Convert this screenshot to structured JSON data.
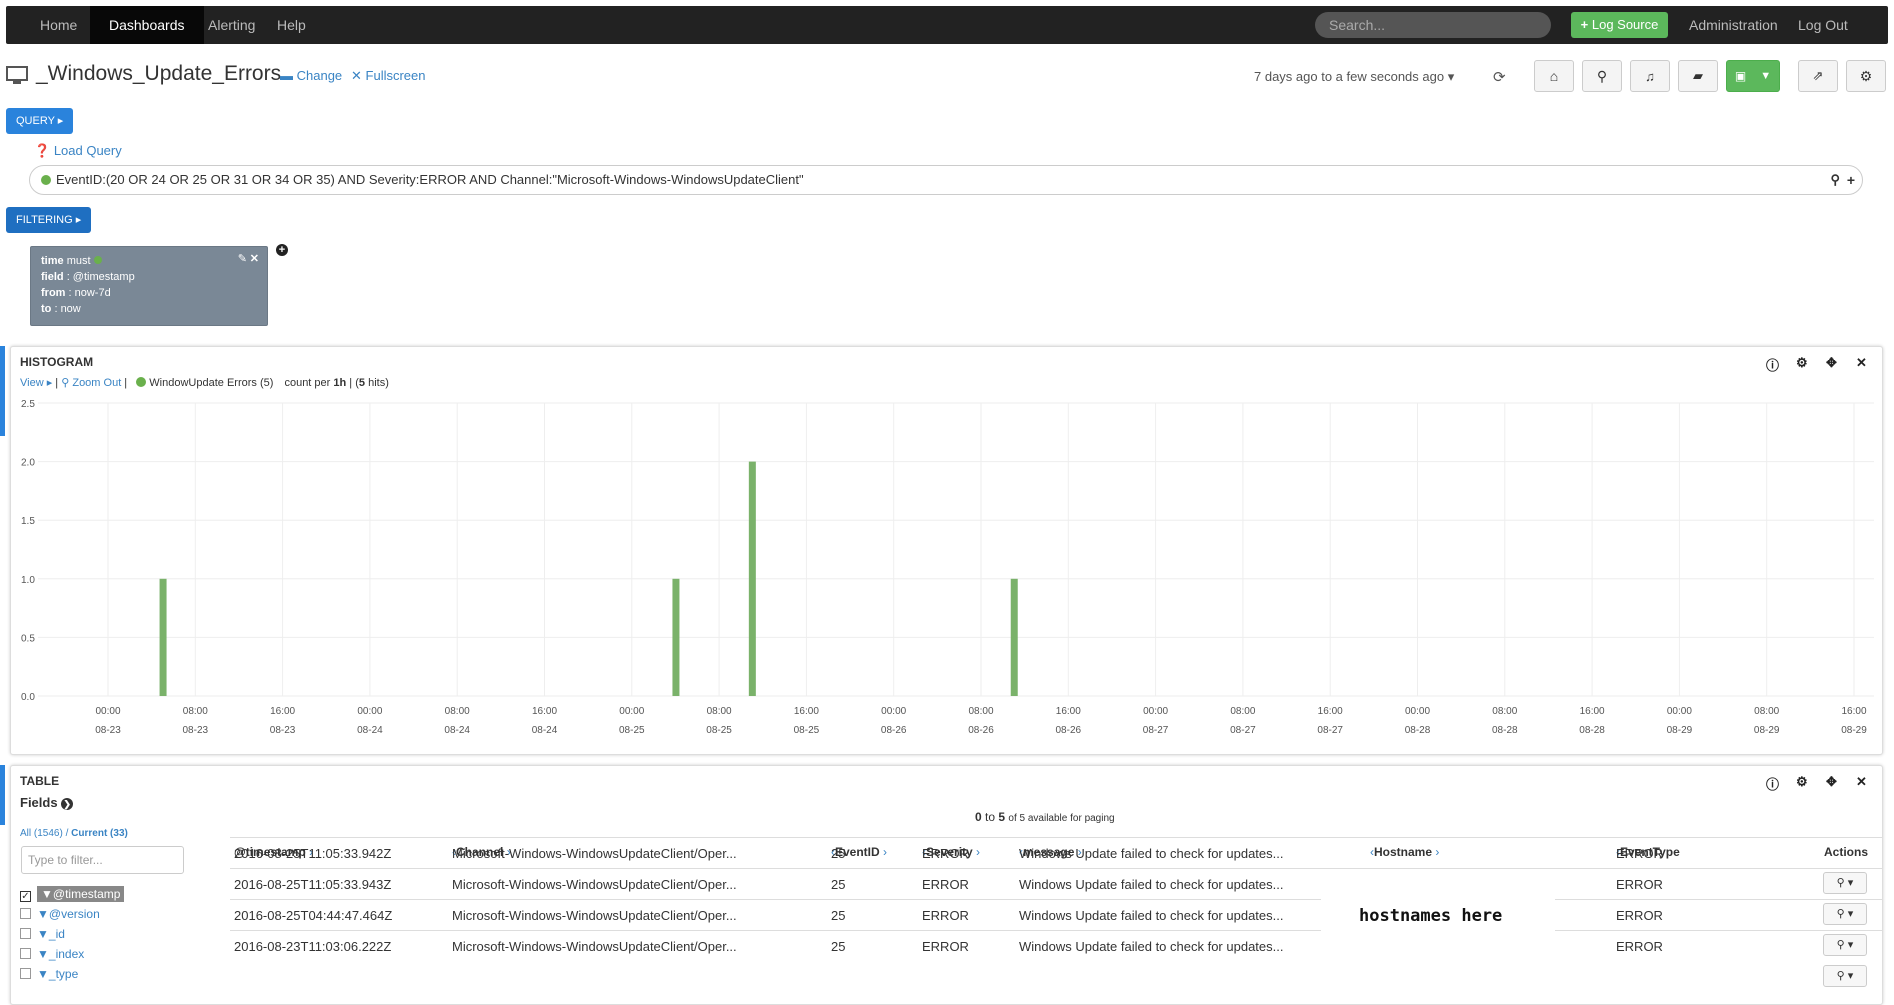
{
  "nav": {
    "items": [
      {
        "label": "Home",
        "active": false
      },
      {
        "label": "Dashboards",
        "active": true
      },
      {
        "label": "Alerting",
        "active": false
      },
      {
        "label": "Help",
        "active": false
      }
    ],
    "search_placeholder": "Search...",
    "log_source_label": "Log Source",
    "administration_label": "Administration",
    "logout_label": "Log Out"
  },
  "header": {
    "title": "_Windows_Update_Errors",
    "change_label": "Change",
    "fullscreen_label": "Fullscreen",
    "time_range": "7 days ago to a few seconds ago"
  },
  "query": {
    "section_label": "QUERY",
    "load_query_label": "Load Query",
    "query_text": "EventID:(20 OR 24 OR 25 OR 31 OR 34 OR 35) AND Severity:ERROR AND Channel:\"Microsoft-Windows-WindowsUpdateClient\"",
    "query_color": "#6ab04c"
  },
  "filtering": {
    "section_label": "FILTERING",
    "card": {
      "time_key": "time",
      "time_value": "must",
      "field_key": "field",
      "field_value": ": @timestamp",
      "from_key": "from",
      "from_value": ": now-7d",
      "to_key": "to",
      "to_value": ": now"
    }
  },
  "histogram": {
    "panel_title": "HISTOGRAM",
    "view_label": "View",
    "zoom_out_label": "Zoom Out",
    "series_label": "WindowUpdate Errors (5)",
    "count_prefix": "count per",
    "interval": "1h",
    "hits_prefix": "(",
    "hits_count": "5",
    "hits_suffix": "hits)"
  },
  "chart_data": {
    "type": "bar",
    "series": [
      {
        "name": "WindowUpdate Errors",
        "color": "#7ab26a",
        "x": [
          "08-23 05:00",
          "08-25 04:00",
          "08-25 11:00",
          "08-26 11:00"
        ],
        "values": [
          1,
          1,
          2,
          1
        ]
      }
    ],
    "ylim": [
      0,
      2.5
    ],
    "y_ticks": [
      "0.0",
      "0.5",
      "1.0",
      "1.5",
      "2.0",
      "2.5"
    ],
    "x_ticks": [
      {
        "time": "00:00",
        "date": "08-23"
      },
      {
        "time": "08:00",
        "date": "08-23"
      },
      {
        "time": "16:00",
        "date": "08-23"
      },
      {
        "time": "00:00",
        "date": "08-24"
      },
      {
        "time": "08:00",
        "date": "08-24"
      },
      {
        "time": "16:00",
        "date": "08-24"
      },
      {
        "time": "00:00",
        "date": "08-25"
      },
      {
        "time": "08:00",
        "date": "08-25"
      },
      {
        "time": "16:00",
        "date": "08-25"
      },
      {
        "time": "00:00",
        "date": "08-26"
      },
      {
        "time": "08:00",
        "date": "08-26"
      },
      {
        "time": "16:00",
        "date": "08-26"
      },
      {
        "time": "00:00",
        "date": "08-27"
      },
      {
        "time": "08:00",
        "date": "08-27"
      },
      {
        "time": "16:00",
        "date": "08-27"
      },
      {
        "time": "00:00",
        "date": "08-28"
      },
      {
        "time": "08:00",
        "date": "08-28"
      },
      {
        "time": "16:00",
        "date": "08-28"
      },
      {
        "time": "00:00",
        "date": "08-29"
      },
      {
        "time": "08:00",
        "date": "08-29"
      },
      {
        "time": "16:00",
        "date": "08-29"
      }
    ],
    "grid": true
  },
  "table": {
    "panel_title": "TABLE",
    "fields_label": "Fields",
    "all_label": "All (1546)",
    "current_label": "Current (33)",
    "filter_placeholder": "Type to filter...",
    "paging_from": "0",
    "paging_to": "5",
    "paging_suffix": "of 5 available for paging",
    "field_list": [
      {
        "name": "@timestamp",
        "checked": true
      },
      {
        "name": "@version",
        "checked": false
      },
      {
        "name": "_id",
        "checked": false
      },
      {
        "name": "_index",
        "checked": false
      },
      {
        "name": "_type",
        "checked": false
      }
    ],
    "columns": [
      "@timestamp",
      "Channel",
      "EventID",
      "Severity",
      "message",
      "Hostname",
      "EventType",
      "Actions"
    ],
    "rows": [
      [
        "2016-08-25T11:05:33.942Z",
        "Microsoft-Windows-WindowsUpdateClient/Oper...",
        "25",
        "ERROR",
        "Windows Update failed to check for updates...",
        "",
        "ERROR"
      ],
      [
        "2016-08-25T11:05:33.943Z",
        "Microsoft-Windows-WindowsUpdateClient/Oper...",
        "25",
        "ERROR",
        "Windows Update failed to check for updates...",
        "",
        "ERROR"
      ],
      [
        "2016-08-25T04:44:47.464Z",
        "Microsoft-Windows-WindowsUpdateClient/Oper...",
        "25",
        "ERROR",
        "Windows Update failed to check for updates...",
        "",
        "ERROR"
      ],
      [
        "2016-08-23T11:03:06.222Z",
        "Microsoft-Windows-WindowsUpdateClient/Oper...",
        "25",
        "ERROR",
        "Windows Update failed to check for updates...",
        "",
        "ERROR"
      ]
    ],
    "hostname_overlay": "hostnames here"
  }
}
